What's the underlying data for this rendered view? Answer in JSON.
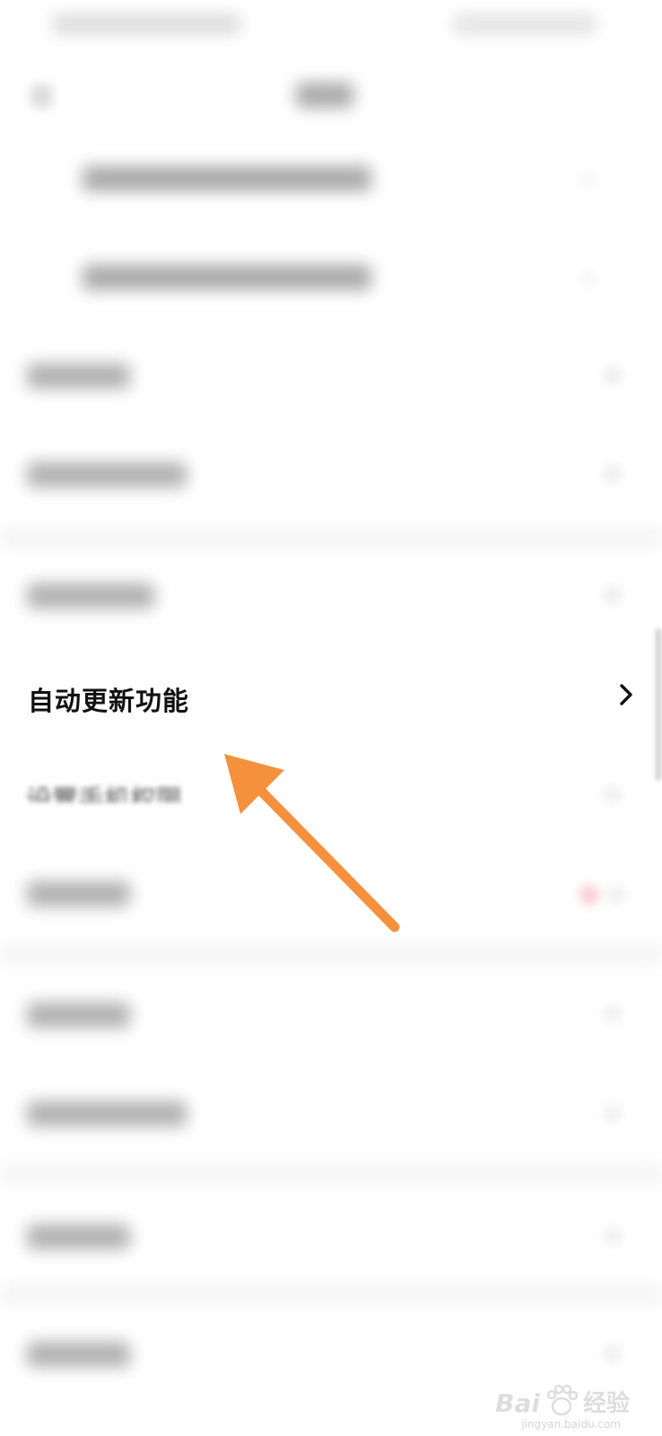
{
  "focused_item": {
    "label": "自动更新功能",
    "chevron_icon": "chevron-right-icon"
  },
  "partial_item": {
    "label": "设置手机权限"
  },
  "annotation": {
    "arrow_color": "#F5913C"
  },
  "watermark": {
    "brand": "Bai",
    "suffix": "经验",
    "url": "jingyan.baidu.com"
  },
  "colors": {
    "background": "#FFFFFF",
    "focus_text": "#111111",
    "accent_dot": "#F06480"
  }
}
